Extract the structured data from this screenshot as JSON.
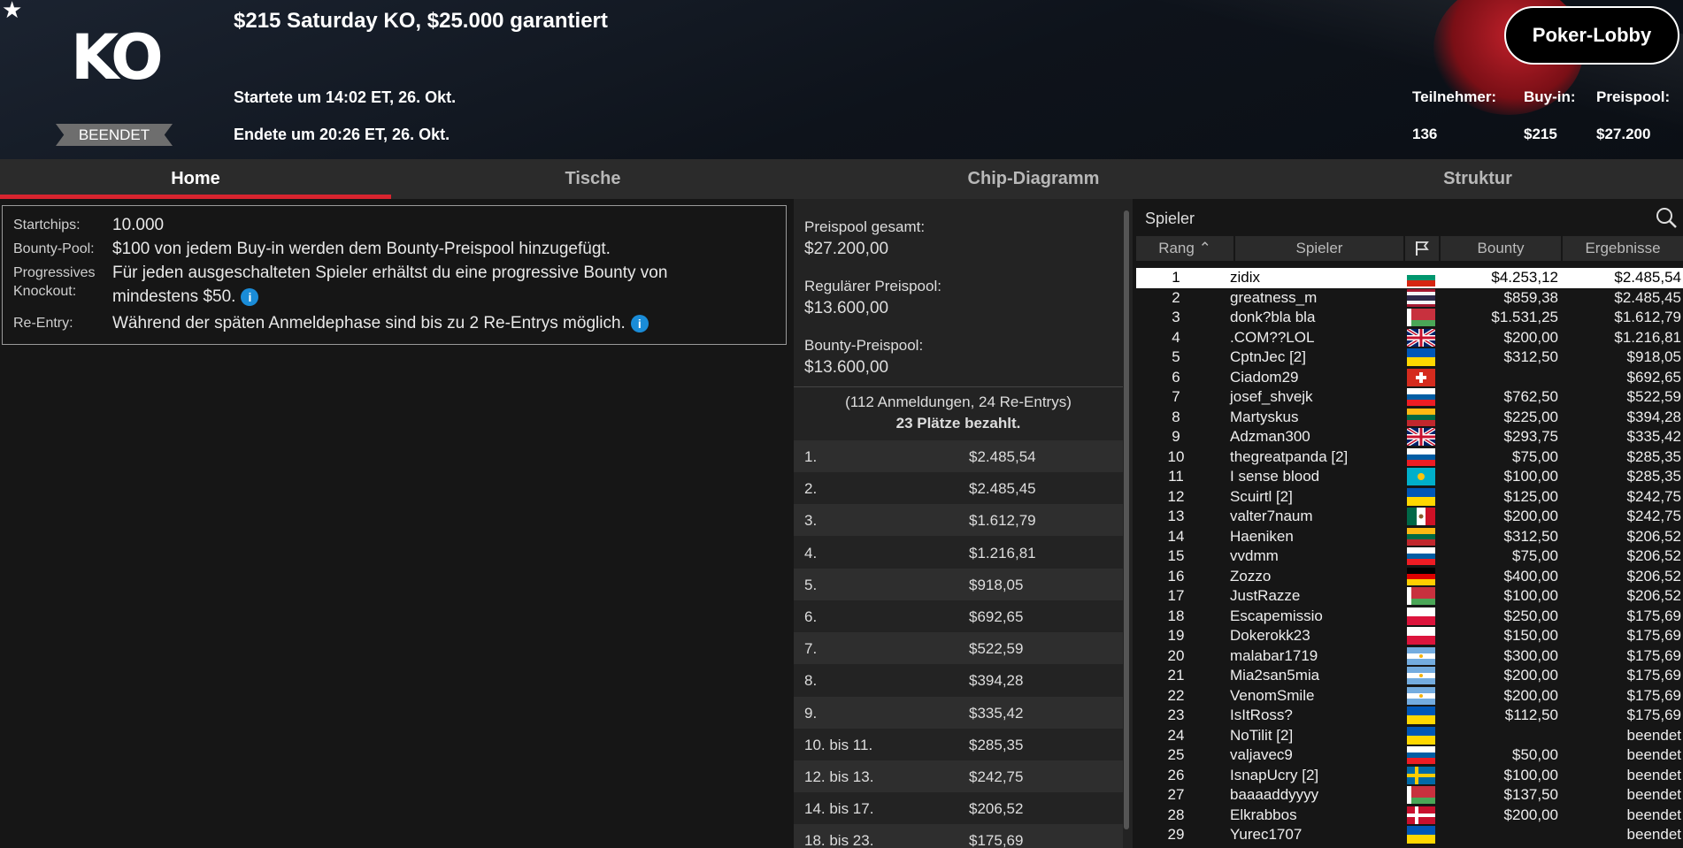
{
  "header": {
    "title": "$215 Saturday KO, $25.000 garantiert",
    "logo": "KO",
    "status": "BEENDET",
    "started": "Startete um 14:02 ET, 26. Okt.",
    "ended": "Endete um 20:26 ET, 26. Okt.",
    "lobby_button": "Poker-Lobby",
    "stats": {
      "participants_label": "Teilnehmer:",
      "participants": "136",
      "buyin_label": "Buy-in:",
      "buyin": "$215",
      "prizepool_label": "Preispool:",
      "prizepool": "$27.200"
    }
  },
  "tabs": [
    {
      "label": "Home"
    },
    {
      "label": "Tische"
    },
    {
      "label": "Chip-Diagramm"
    },
    {
      "label": "Struktur"
    }
  ],
  "info": {
    "startchips_label": "Startchips:",
    "startchips": "10.000",
    "bounty_label": "Bounty-Pool:",
    "bounty": "$100 von jedem Buy-in werden dem Bounty-Preispool hinzugefügt.",
    "pko_label1": "Progressives",
    "pko_label2": "Knockout:",
    "pko_line1": "Für jeden ausgeschalteten Spieler erhältst du eine progressive Bounty von",
    "pko_line2": "mindestens $50.",
    "reentry_label": "Re-Entry:",
    "reentry": "Während der späten Anmeldephase sind bis zu 2 Re-Entrys möglich.",
    "icon_glyph": "i"
  },
  "prizes": {
    "total_label": "Preispool gesamt:",
    "total": "$27.200,00",
    "regular_label": "Regulärer Preispool:",
    "regular": "$13.600,00",
    "bounty_label": "Bounty-Preispool:",
    "bounty": "$13.600,00",
    "entries": "(112 Anmeldungen, 24 Re-Entrys)",
    "paid": "23 Plätze bezahlt.",
    "places": [
      {
        "place": "1.",
        "amount": "$2.485,54"
      },
      {
        "place": "2.",
        "amount": "$2.485,45"
      },
      {
        "place": "3.",
        "amount": "$1.612,79"
      },
      {
        "place": "4.",
        "amount": "$1.216,81"
      },
      {
        "place": "5.",
        "amount": "$918,05"
      },
      {
        "place": "6.",
        "amount": "$692,65"
      },
      {
        "place": "7.",
        "amount": "$522,59"
      },
      {
        "place": "8.",
        "amount": "$394,28"
      },
      {
        "place": "9.",
        "amount": "$335,42"
      },
      {
        "place": "10. bis 11.",
        "amount": "$285,35"
      },
      {
        "place": "12. bis 13.",
        "amount": "$242,75"
      },
      {
        "place": "14. bis 17.",
        "amount": "$206,52"
      },
      {
        "place": "18. bis 23.",
        "amount": "$175,69"
      }
    ]
  },
  "players": {
    "title": "Spieler",
    "columns": {
      "rank": "Rang",
      "name": "Spieler",
      "bounty": "Bounty",
      "result": "Ergebnisse"
    },
    "rows": [
      {
        "rank": "1",
        "name": "zidix",
        "flag": "bg",
        "bounty": "$4.253,12",
        "result": "$2.485,54"
      },
      {
        "rank": "2",
        "name": "greatness_m",
        "flag": "th",
        "bounty": "$859,38",
        "result": "$2.485,45"
      },
      {
        "rank": "3",
        "name": "donk?bla bla",
        "flag": "by",
        "bounty": "$1.531,25",
        "result": "$1.612,79"
      },
      {
        "rank": "4",
        "name": ".COM??LOL",
        "flag": "gb",
        "bounty": "$200,00",
        "result": "$1.216,81"
      },
      {
        "rank": "5",
        "name": "CptnJec [2]",
        "flag": "ua",
        "bounty": "$312,50",
        "result": "$918,05"
      },
      {
        "rank": "6",
        "name": "Ciadom29",
        "flag": "ch",
        "bounty": "",
        "result": "$692,65"
      },
      {
        "rank": "7",
        "name": "josef_shvejk",
        "flag": "si",
        "bounty": "$762,50",
        "result": "$522,59"
      },
      {
        "rank": "8",
        "name": "Martyskus",
        "flag": "lt",
        "bounty": "$225,00",
        "result": "$394,28"
      },
      {
        "rank": "9",
        "name": "Adzman300",
        "flag": "gb",
        "bounty": "$293,75",
        "result": "$335,42"
      },
      {
        "rank": "10",
        "name": "thegreatpanda [2]",
        "flag": "si",
        "bounty": "$75,00",
        "result": "$285,35"
      },
      {
        "rank": "11",
        "name": "I sense blood",
        "flag": "kz",
        "bounty": "$100,00",
        "result": "$285,35"
      },
      {
        "rank": "12",
        "name": "Scuirtl [2]",
        "flag": "ua",
        "bounty": "$125,00",
        "result": "$242,75"
      },
      {
        "rank": "13",
        "name": "valter7naum",
        "flag": "mx",
        "bounty": "$200,00",
        "result": "$242,75"
      },
      {
        "rank": "14",
        "name": "Haeniken",
        "flag": "lt",
        "bounty": "$312,50",
        "result": "$206,52"
      },
      {
        "rank": "15",
        "name": "vvdmm",
        "flag": "si",
        "bounty": "$75,00",
        "result": "$206,52"
      },
      {
        "rank": "16",
        "name": "Zozzo",
        "flag": "de",
        "bounty": "$400,00",
        "result": "$206,52"
      },
      {
        "rank": "17",
        "name": "JustRazze",
        "flag": "by",
        "bounty": "$100,00",
        "result": "$206,52"
      },
      {
        "rank": "18",
        "name": "Escapemissio",
        "flag": "pl",
        "bounty": "$250,00",
        "result": "$175,69"
      },
      {
        "rank": "19",
        "name": "Dokerokk23",
        "flag": "pl",
        "bounty": "$150,00",
        "result": "$175,69"
      },
      {
        "rank": "20",
        "name": "malabar1719",
        "flag": "ar",
        "bounty": "$300,00",
        "result": "$175,69"
      },
      {
        "rank": "21",
        "name": "Mia2san5mia",
        "flag": "ar",
        "bounty": "$200,00",
        "result": "$175,69"
      },
      {
        "rank": "22",
        "name": "VenomSmile",
        "flag": "ar",
        "bounty": "$200,00",
        "result": "$175,69"
      },
      {
        "rank": "23",
        "name": "IsItRoss?",
        "flag": "ua",
        "bounty": "$112,50",
        "result": "$175,69"
      },
      {
        "rank": "24",
        "name": "NoTilit [2]",
        "flag": "ua",
        "bounty": "",
        "result": "beendet"
      },
      {
        "rank": "25",
        "name": "valjavec9",
        "flag": "si",
        "bounty": "$50,00",
        "result": "beendet"
      },
      {
        "rank": "26",
        "name": "IsnapUcry [2]",
        "flag": "se",
        "bounty": "$100,00",
        "result": "beendet"
      },
      {
        "rank": "27",
        "name": "baaaaddyyyy",
        "flag": "by",
        "bounty": "$137,50",
        "result": "beendet"
      },
      {
        "rank": "28",
        "name": "Elkrabbos",
        "flag": "dk",
        "bounty": "$200,00",
        "result": "beendet"
      },
      {
        "rank": "29",
        "name": "Yurec1707",
        "flag": "ua",
        "bounty": "",
        "result": "beendet"
      }
    ]
  },
  "colors": {
    "accent": "#d8242f",
    "info_icon": "#1a8cd8"
  }
}
